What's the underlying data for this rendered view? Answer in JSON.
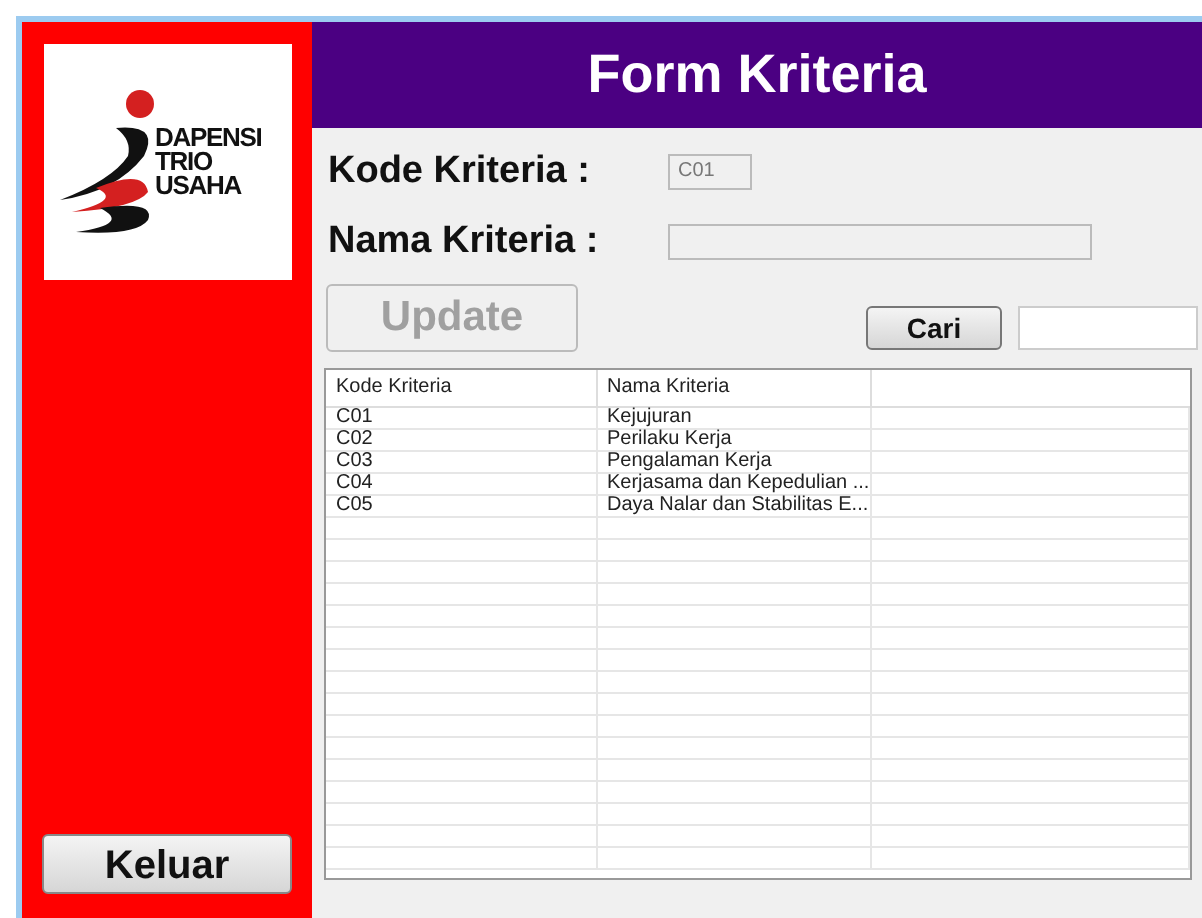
{
  "logo": {
    "lines": [
      "DAPENSI",
      "TRIO",
      "USAHA"
    ]
  },
  "header": {
    "title": "Form Kriteria"
  },
  "form": {
    "kode_label": "Kode Kriteria :",
    "kode_value": "C01",
    "kode_disabled": true,
    "nama_label": "Nama Kriteria :",
    "update_button": "Update",
    "update_disabled": true,
    "search_button": "Cari"
  },
  "table": {
    "columns": [
      "Kode Kriteria",
      "Nama Kriteria"
    ],
    "rows": [
      [
        "C01",
        "Kejujuran"
      ],
      [
        "C02",
        "Perilaku Kerja"
      ],
      [
        "C03",
        "Pengalaman Kerja"
      ],
      [
        "C04",
        "Kerjasama dan Kepedulian ..."
      ],
      [
        "C05",
        "Daya Nalar dan Stabilitas E..."
      ]
    ]
  },
  "exit_button": "Keluar"
}
